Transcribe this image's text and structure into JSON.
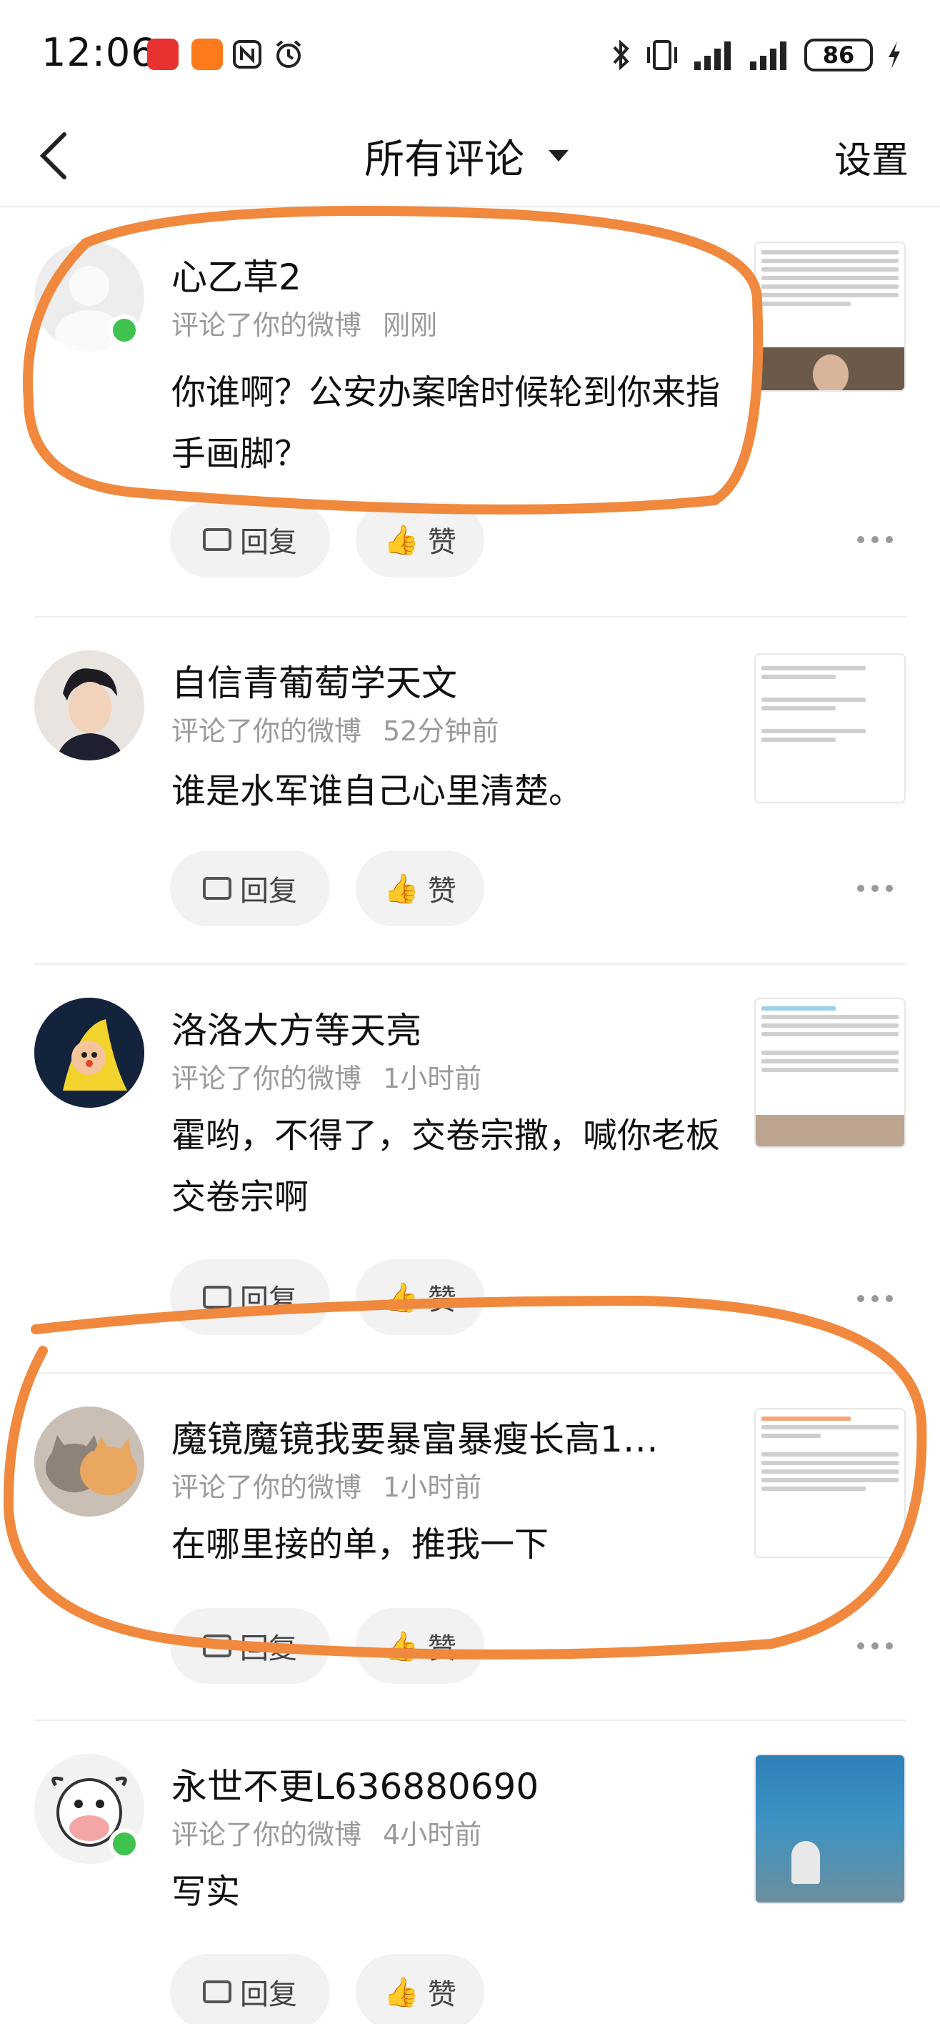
{
  "status_bar": {
    "time": "12:06",
    "battery": "86",
    "icons": [
      "huawei-store-icon",
      "app-icon",
      "nfc-icon",
      "alarm-icon",
      "bluetooth-icon",
      "vibrate-icon",
      "signal-icon",
      "signal-icon",
      "charging-icon"
    ]
  },
  "nav": {
    "title": "所有评论",
    "settings": "设置"
  },
  "comments": [
    {
      "username": "心乙草2",
      "meta": "评论了你的微博",
      "time": "刚刚",
      "text": "你谁啊？公安办案啥时候轮到你来指手画脚？",
      "reply": "回复",
      "like": "赞",
      "online": true,
      "thumb": "text"
    },
    {
      "username": "自信青葡萄学天文",
      "meta": "评论了你的微博",
      "time": "52分钟前",
      "text": "谁是水军谁自己心里清楚。",
      "reply": "回复",
      "like": "赞",
      "online": false,
      "thumb": "comments"
    },
    {
      "username": "洛洛大方等天亮",
      "meta": "评论了你的微博",
      "time": "1小时前",
      "text": "霍哟，不得了，交卷宗撒，喊你老板交卷宗啊",
      "reply": "回复",
      "like": "赞",
      "online": false,
      "thumb": "post"
    },
    {
      "username": "魔镜魔镜我要暴富暴瘦长高1…",
      "meta": "评论了你的微博",
      "time": "1小时前",
      "text": "在哪里接的单，推我一下",
      "reply": "回复",
      "like": "赞",
      "online": false,
      "thumb": "post2"
    },
    {
      "username": "永世不更L636880690",
      "meta": "评论了你的微博",
      "time": "4小时前",
      "text": "写实",
      "reply": "回复",
      "like": "赞",
      "online": true,
      "thumb": "photo"
    }
  ],
  "colors": {
    "annotation": "#f0883e",
    "online": "#3fc24e",
    "meta": "#9a9a9a",
    "pill": "#f2f2f2"
  }
}
